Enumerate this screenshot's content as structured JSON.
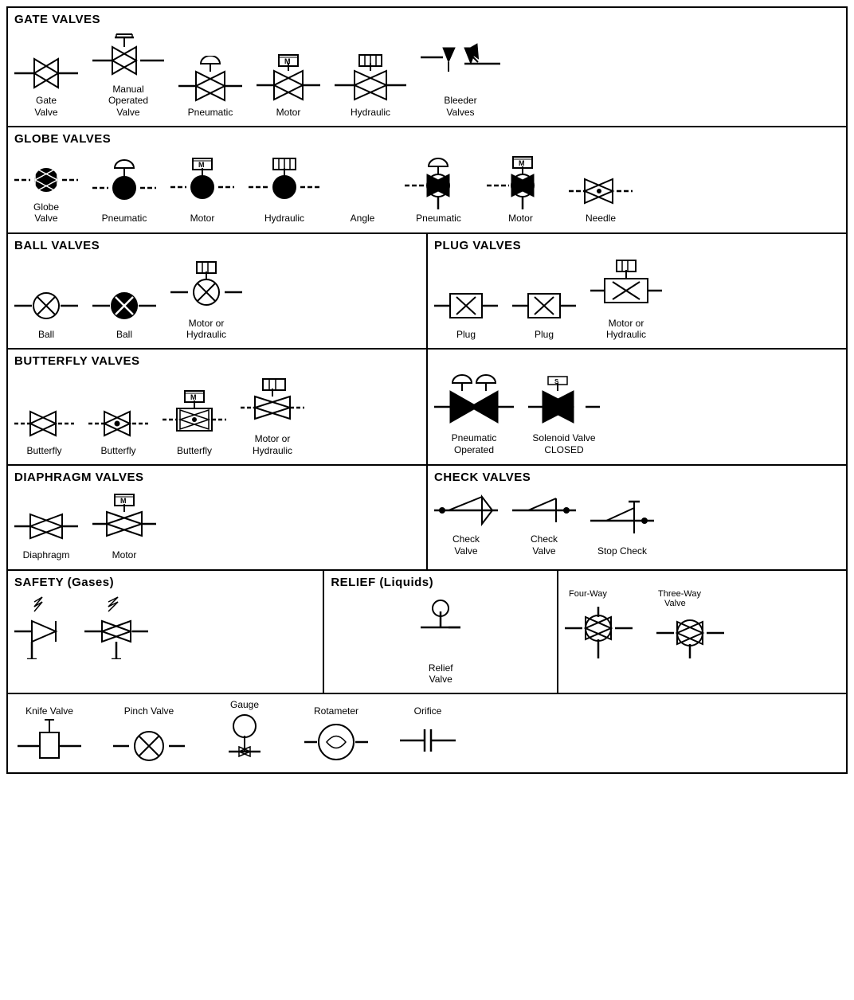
{
  "sections": {
    "gate_valves": {
      "title": "GATE VALVES",
      "items": [
        {
          "label": "Gate\nValve"
        },
        {
          "label": "Manual\nOperated\nValve"
        },
        {
          "label": "Pneumatic"
        },
        {
          "label": "Motor"
        },
        {
          "label": "Hydraulic"
        },
        {
          "label": "Bleeder\nValves"
        }
      ]
    },
    "globe_valves": {
      "title": "GLOBE VALVES",
      "items": [
        {
          "label": "Globe\nValve"
        },
        {
          "label": "Pneumatic"
        },
        {
          "label": "Motor"
        },
        {
          "label": "Hydraulic"
        },
        {
          "label": "Angle"
        },
        {
          "label": "Pneumatic"
        },
        {
          "label": "Motor"
        },
        {
          "label": "Needle"
        }
      ]
    },
    "ball_valves": {
      "title": "BALL VALVES",
      "items": [
        {
          "label": "Ball"
        },
        {
          "label": "Ball"
        },
        {
          "label": "Motor or\nHydraulic"
        }
      ]
    },
    "plug_valves": {
      "title": "PLUG VALVES",
      "items": [
        {
          "label": "Plug"
        },
        {
          "label": "Plug"
        },
        {
          "label": "Motor or\nHydraulic"
        }
      ]
    },
    "butterfly_valves": {
      "title": "BUTTERFLY VALVES",
      "items": [
        {
          "label": "Butterfly"
        },
        {
          "label": "Butterfly"
        },
        {
          "label": "Butterfly"
        },
        {
          "label": "Motor or\nHydraulic"
        }
      ]
    },
    "special_valves": {
      "items": [
        {
          "label": "Pneumatic\nOperated"
        },
        {
          "label": "Solenoid Valve\nCLOSED"
        }
      ]
    },
    "diaphragm_valves": {
      "title": "DIAPHRAGM VALVES",
      "items": [
        {
          "label": "Diaphragm"
        },
        {
          "label": "Motor"
        }
      ]
    },
    "check_valves": {
      "title": "CHECK VALVES",
      "items": [
        {
          "label": "Check\nValve"
        },
        {
          "label": "Check\nValve"
        },
        {
          "label": "Stop Check"
        }
      ]
    },
    "safety": {
      "title": "SAFETY (Gases)"
    },
    "relief": {
      "title": "RELIEF (Liquids)",
      "items": [
        {
          "label": "Relief\nValve"
        }
      ]
    },
    "fourway": {
      "items": [
        {
          "label": "Four-Way"
        },
        {
          "label": "Three-Way\nValve"
        }
      ]
    },
    "bottom": {
      "items": [
        {
          "label": "Knife Valve"
        },
        {
          "label": "Pinch Valve"
        },
        {
          "label": "Gauge"
        },
        {
          "label": "Rotameter"
        },
        {
          "label": "Orifice"
        }
      ]
    }
  }
}
